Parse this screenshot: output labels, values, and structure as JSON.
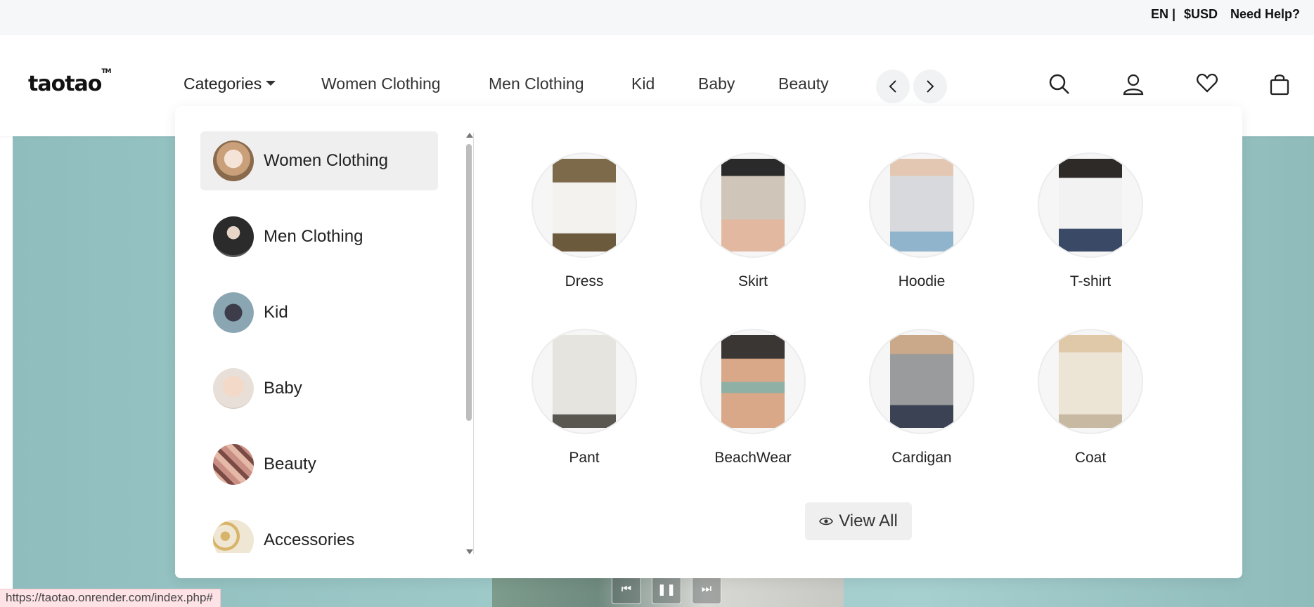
{
  "topbar": {
    "language": "EN |",
    "currency": "$USD",
    "help": "Need Help?"
  },
  "header": {
    "logo": "taotao",
    "logo_mark": "TM",
    "nav": {
      "categories": "Categories",
      "items": [
        "Women Clothing",
        "Men Clothing",
        "Kid",
        "Baby",
        "Beauty"
      ]
    },
    "icons": [
      "chevron-left-icon",
      "chevron-right-icon",
      "search-icon",
      "user-icon",
      "heart-icon",
      "bag-icon"
    ]
  },
  "dropdown": {
    "categories": [
      {
        "label": "Women Clothing",
        "active": true
      },
      {
        "label": "Men Clothing",
        "active": false
      },
      {
        "label": "Kid",
        "active": false
      },
      {
        "label": "Baby",
        "active": false
      },
      {
        "label": "Beauty",
        "active": false
      },
      {
        "label": "Accessories",
        "active": false
      }
    ],
    "subcategories": [
      {
        "label": "Dress"
      },
      {
        "label": "Skirt"
      },
      {
        "label": "Hoodie"
      },
      {
        "label": "T-shirt"
      },
      {
        "label": "Pant"
      },
      {
        "label": "BeachWear"
      },
      {
        "label": "Cardigan"
      },
      {
        "label": "Coat"
      }
    ],
    "view_all": "View All"
  },
  "hero": {
    "controls": [
      "skip-back-icon",
      "pause-icon",
      "skip-forward-icon"
    ]
  },
  "statusbar": {
    "url": "https://taotao.onrender.com/index.php#"
  },
  "colors": {
    "hero_bg": "#9fcaca",
    "panel_active": "#efefef",
    "statusbar_bg": "#fde2e6"
  }
}
